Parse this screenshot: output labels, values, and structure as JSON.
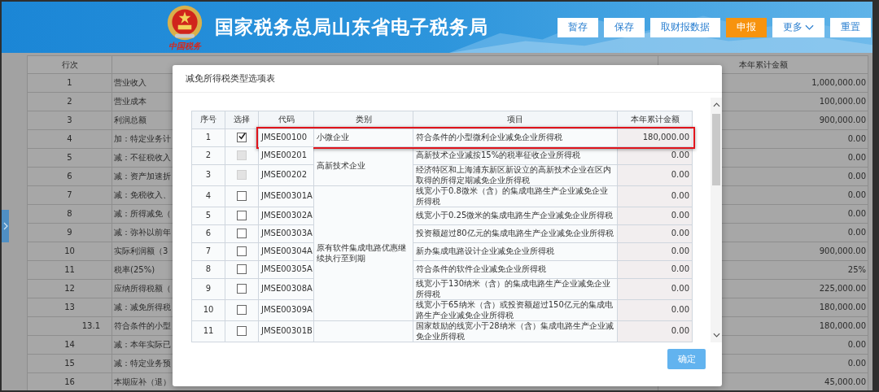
{
  "header": {
    "title": "国家税务总局山东省电子税务局",
    "logo_caption": "中国税务",
    "buttons": [
      {
        "label": "暂存",
        "kind": "plain"
      },
      {
        "label": "保存",
        "kind": "plain"
      },
      {
        "label": "取财报数据",
        "kind": "plain"
      },
      {
        "label": "申报",
        "kind": "primary"
      },
      {
        "label": "更多",
        "kind": "menu"
      },
      {
        "label": "重置",
        "kind": "plain"
      }
    ]
  },
  "form_table": {
    "columns": [
      "行次",
      "本年累计金额"
    ],
    "rows": [
      {
        "no": "1",
        "item": "营业收入",
        "amount": "1,000,000.00",
        "kind": "main"
      },
      {
        "no": "2",
        "item": "营业成本",
        "amount": "100,000.00",
        "kind": "main"
      },
      {
        "no": "3",
        "item": "利润总额",
        "amount": "900,000.00",
        "kind": "main"
      },
      {
        "no": "4",
        "item": "加：特定业务计",
        "amount": "0.00",
        "kind": "main"
      },
      {
        "no": "5",
        "item": "减：不征税收入",
        "amount": "0.00",
        "kind": "main"
      },
      {
        "no": "6",
        "item": "减：资产加速折",
        "amount": "0.00",
        "kind": "main"
      },
      {
        "no": "7",
        "item": "减：免税收入、",
        "amount": "0.00",
        "kind": "main"
      },
      {
        "no": "8",
        "item": "减：所得减免（",
        "amount": "0.00",
        "kind": "main"
      },
      {
        "no": "9",
        "item": "减：弥补以前年",
        "amount": "0.00",
        "kind": "main"
      },
      {
        "no": "10",
        "item": "实际利润额（3",
        "amount": "900,000.00",
        "kind": "main"
      },
      {
        "no": "11",
        "item": "税率(25%)",
        "amount": "25%",
        "kind": "main"
      },
      {
        "no": "12",
        "item": "应纳所得税额（",
        "amount": "225,000.00",
        "kind": "main"
      },
      {
        "no": "13",
        "item": "减：减免所得税",
        "amount": "180,000.00",
        "kind": "main"
      },
      {
        "no": "13.1",
        "item": "符合条件的小型",
        "amount": "180,000.00",
        "kind": "sub"
      },
      {
        "no": "14",
        "item": "减：本年实际已",
        "amount": "0.00",
        "kind": "main"
      },
      {
        "no": "15",
        "item": "减：特定业务预",
        "amount": "0.00",
        "kind": "main"
      },
      {
        "no": "16",
        "item": "本期应补（退）",
        "amount": "45,000.00",
        "kind": "main"
      }
    ]
  },
  "modal": {
    "title": "减免所得税类型选项表",
    "columns": [
      "序号",
      "选择",
      "代码",
      "类别",
      "项目",
      "本年累计金额"
    ],
    "groups": [
      {
        "category": "小微企业",
        "rows": [
          {
            "no": "1",
            "checked": true,
            "disabled": false,
            "highlighted": true,
            "code": "JMSE00100",
            "item": "符合条件的小型微利企业减免企业所得税",
            "amount": "180,000.00"
          }
        ]
      },
      {
        "category": "高新技术企业",
        "rows": [
          {
            "no": "2",
            "checked": false,
            "disabled": true,
            "highlighted": false,
            "code": "JMSE00201",
            "item": "高新技术企业减按15%的税率征收企业所得税",
            "amount": "0.00"
          },
          {
            "no": "3",
            "checked": false,
            "disabled": true,
            "highlighted": false,
            "code": "JMSE00202",
            "item": "经济特区和上海浦东新区新设立的高新技术企业在区内取得的所得定期减免企业所得税",
            "amount": "0.00"
          }
        ]
      },
      {
        "category": "原有软件集成电路优惠继续执行至到期",
        "rows": [
          {
            "no": "4",
            "checked": false,
            "disabled": false,
            "highlighted": false,
            "code": "JMSE00301A",
            "item": "线宽小于0.8微米（含）的集成电路生产企业减免企业所得税",
            "amount": "0.00"
          },
          {
            "no": "5",
            "checked": false,
            "disabled": false,
            "highlighted": false,
            "code": "JMSE00302A",
            "item": "线宽小于0.25微米的集成电路生产企业减免企业所得税",
            "amount": "0.00"
          },
          {
            "no": "6",
            "checked": false,
            "disabled": false,
            "highlighted": false,
            "code": "JMSE00303A",
            "item": "投资额超过80亿元的集成电路生产企业减免企业所得税",
            "amount": "0.00"
          },
          {
            "no": "7",
            "checked": false,
            "disabled": false,
            "highlighted": false,
            "code": "JMSE00304A",
            "item": "新办集成电路设计企业减免企业所得税",
            "amount": "0.00"
          },
          {
            "no": "8",
            "checked": false,
            "disabled": false,
            "highlighted": false,
            "code": "JMSE00305A",
            "item": "符合条件的软件企业减免企业所得税",
            "amount": "0.00"
          },
          {
            "no": "9",
            "checked": false,
            "disabled": false,
            "highlighted": false,
            "code": "JMSE00308A",
            "item": "线宽小于130纳米（含）的集成电路生产企业减免企业所得税",
            "amount": "0.00"
          },
          {
            "no": "10",
            "checked": false,
            "disabled": false,
            "highlighted": false,
            "code": "JMSE00309A",
            "item": "线宽小于65纳米（含）或投资额超过150亿元的集成电路生产企业减免企业所得税",
            "amount": "0.00"
          }
        ]
      },
      {
        "rows": [
          {
            "no": "11",
            "checked": false,
            "disabled": false,
            "highlighted": false,
            "code": "JMSE00301B",
            "item": "国家鼓励的线宽小于28纳米（含）集成电路生产企业减免企业所得税",
            "amount": "0.00"
          }
        ]
      }
    ],
    "confirm_button": "确定"
  }
}
